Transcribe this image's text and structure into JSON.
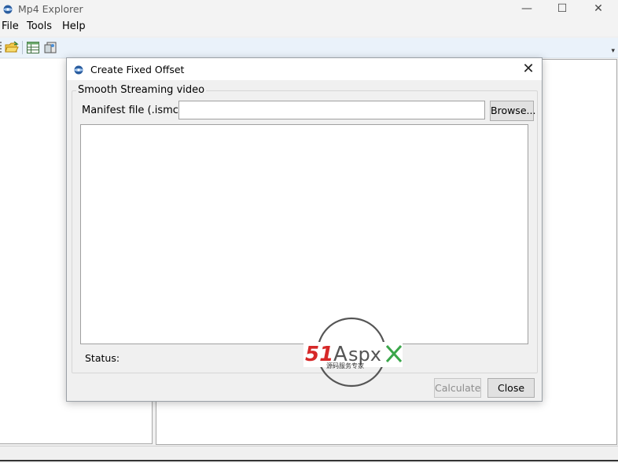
{
  "app": {
    "title": "Mp4 Explorer",
    "minimize_glyph": "—",
    "maximize_glyph": "☐",
    "close_glyph": "✕"
  },
  "menu": {
    "items": [
      {
        "label": "File"
      },
      {
        "label": "Tools"
      },
      {
        "label": "Help"
      }
    ]
  },
  "toolbar": {
    "buttons": [
      {
        "icon": "open-folder-icon"
      },
      {
        "icon": "table-icon"
      },
      {
        "icon": "export-icon"
      }
    ],
    "overflow_glyph": "▾"
  },
  "dialog": {
    "title": "Create Fixed Offset",
    "close_glyph": "✕",
    "group_title": "Smooth Streaming video",
    "manifest_label": "Manifest file (.ismc):",
    "manifest_value": "",
    "browse_label": "Browse...",
    "status_label": "Status:",
    "calculate_label": "Calculate",
    "close_label": "Close"
  },
  "watermark": {
    "brand": "51Aspx",
    "brand_num": "51",
    "brand_a": "A",
    "brand_rest": "spx",
    "tagline": "源码服务专家"
  },
  "colors": {
    "watermark_red": "#d62828",
    "watermark_gray": "#555555",
    "watermark_green": "#3aa64a",
    "toolbar_bg": "#eaf2fa"
  }
}
